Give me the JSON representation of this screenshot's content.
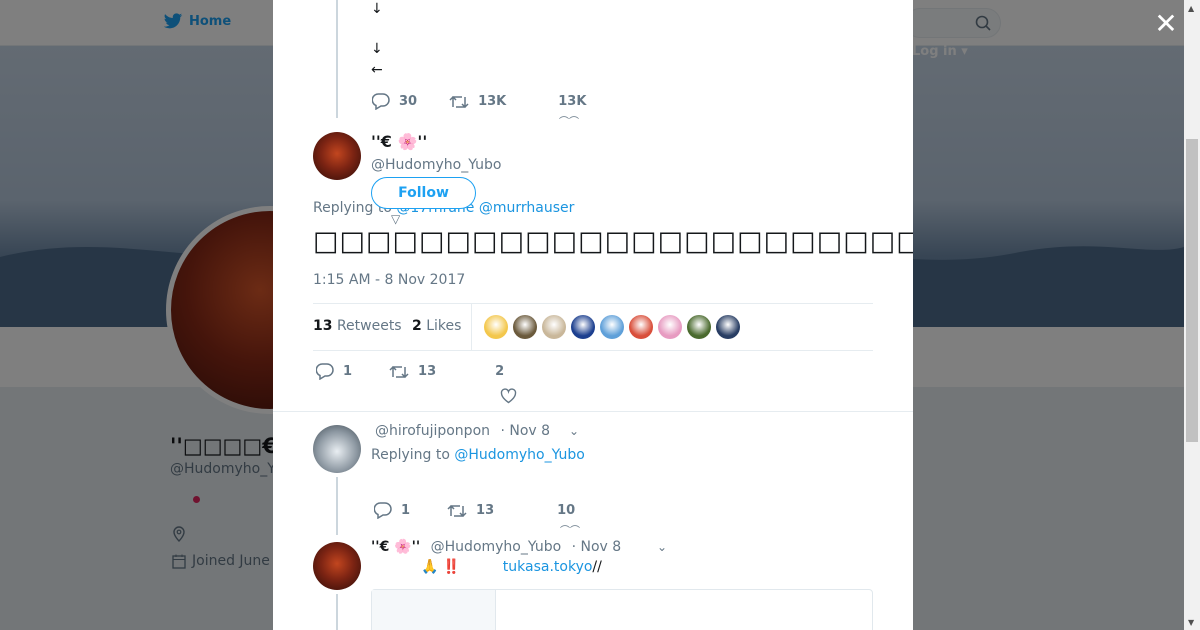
{
  "bg": {
    "home_label": "Home",
    "login_label": "Log in",
    "profile_name": "''□□□□€□□",
    "profile_handle": "@Hudomyho_Y",
    "joined": "Joined June"
  },
  "colors": {
    "accent": "#1da1f2",
    "link": "#1b95e0",
    "muted": "#657786"
  },
  "modal": {
    "close_label": "✕",
    "prev_tweet": {
      "arrows": [
        "↓",
        "↓",
        "←"
      ],
      "replies": "30",
      "retweets": "13K",
      "likes": "13K"
    },
    "main_tweet": {
      "name": "''€   🌸''",
      "handle": "@Hudomyho_Yubo",
      "follow_label": "Follow",
      "replying_prefix": "Replying to",
      "replying_to": "@17rhrane @murrhauser",
      "text": "□□□□□□□□□□□□□□□□□□□□□□□",
      "timestamp": "1:15 AM - 8 Nov 2017",
      "retweets_count": "13",
      "retweets_label": "Retweets",
      "likes_count": "2",
      "likes_label": "Likes",
      "liker_colors": [
        "#f3c74c",
        "#6b5a3c",
        "#c9b79a",
        "#1c3f8f",
        "#5fa0d9",
        "#d94f3b",
        "#e79bc1",
        "#4a6a2e",
        "#283d63"
      ],
      "action_replies": "1",
      "action_retweets": "13",
      "action_likes": "2"
    },
    "reply_1": {
      "handle": "@hirofujiponpon",
      "date": "· Nov 8",
      "replying_prefix": "Replying to",
      "replying_to": "@Hudomyho_Yubo",
      "replies": "1",
      "retweets": "13",
      "likes": "10"
    },
    "reply_2": {
      "name": "''€   🌸''",
      "handle": "@Hudomyho_Yubo",
      "date": "· Nov 8",
      "text_emoji": "🙏      ‼️",
      "link": "tukasa.tokyo",
      "link_suffix": "//"
    }
  }
}
